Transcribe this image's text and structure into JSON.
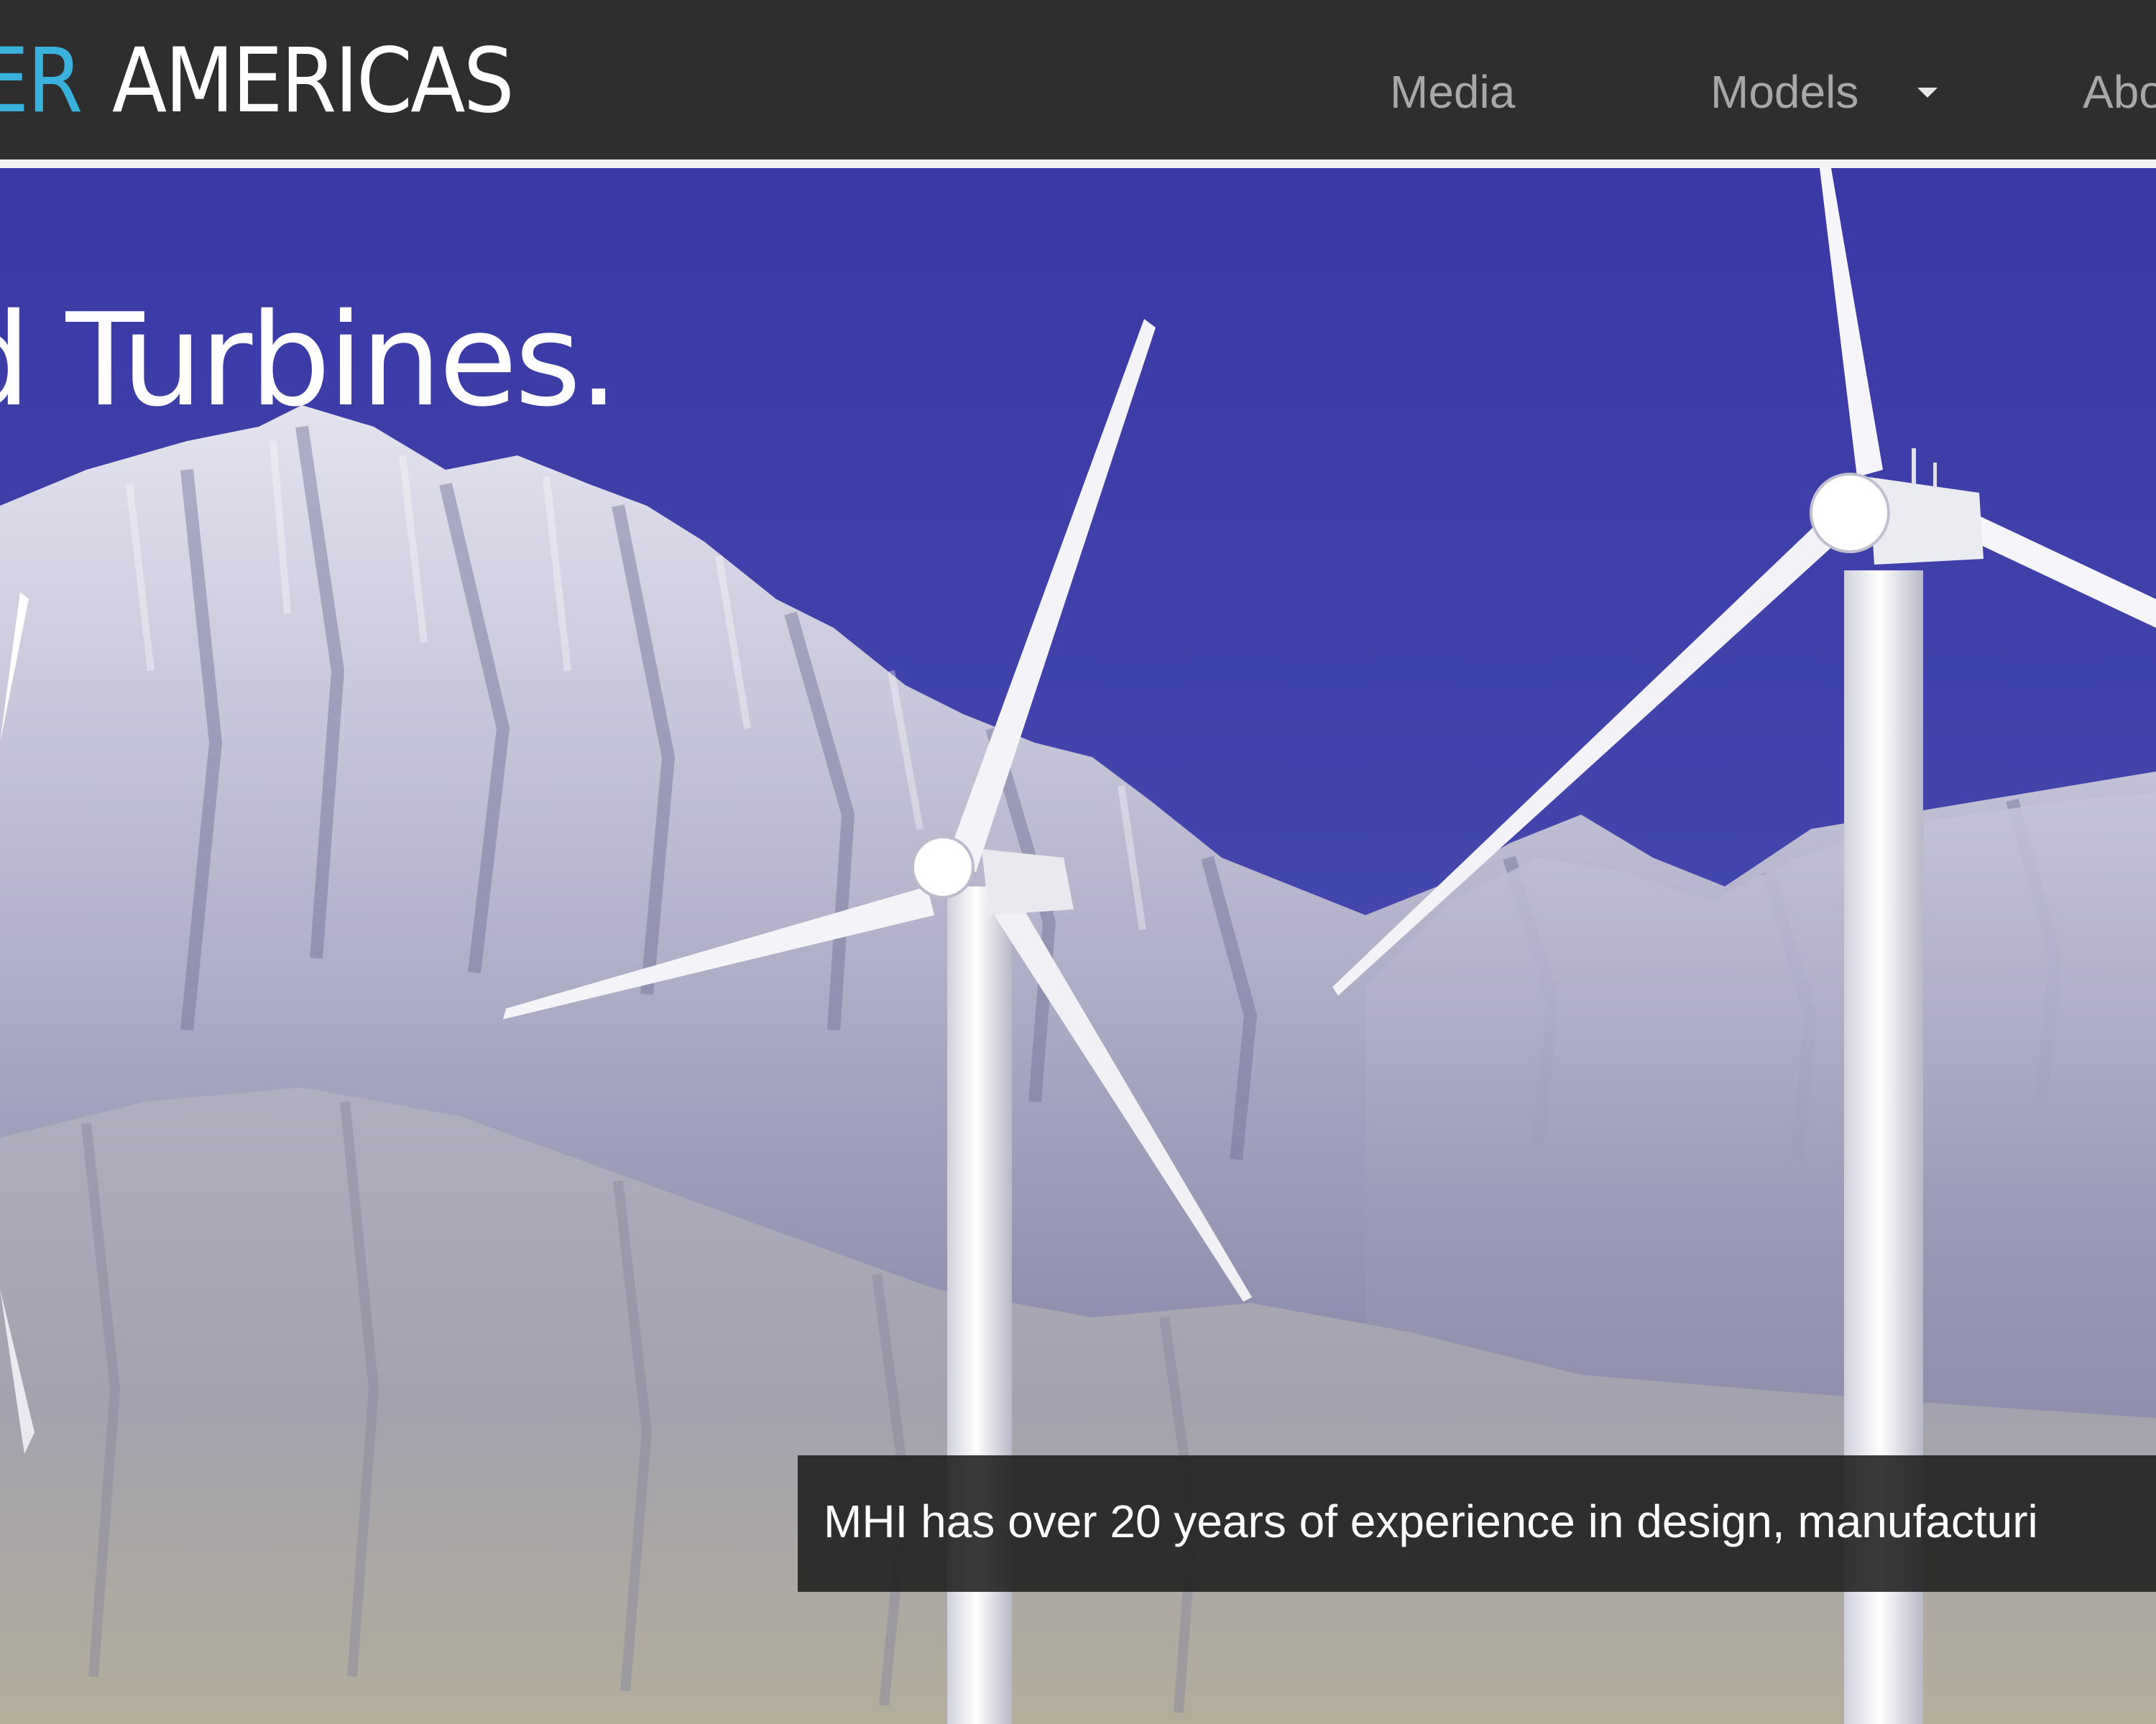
{
  "header": {
    "brand_accent": "ER",
    "brand_main": "AMERICAS",
    "nav": {
      "media": "Media",
      "models": "Models",
      "about": "Abo"
    }
  },
  "hero": {
    "heading": "d Turbines.",
    "image": "wind-turbines-mountain-photo",
    "caption": "MHI has over 20 years of experience in design, manufacturi"
  },
  "colors": {
    "nav_background": "#2e2e2e",
    "brand_accent": "#3ab1dc",
    "nav_text": "#a8a8a8",
    "sky": "#4245ad"
  }
}
